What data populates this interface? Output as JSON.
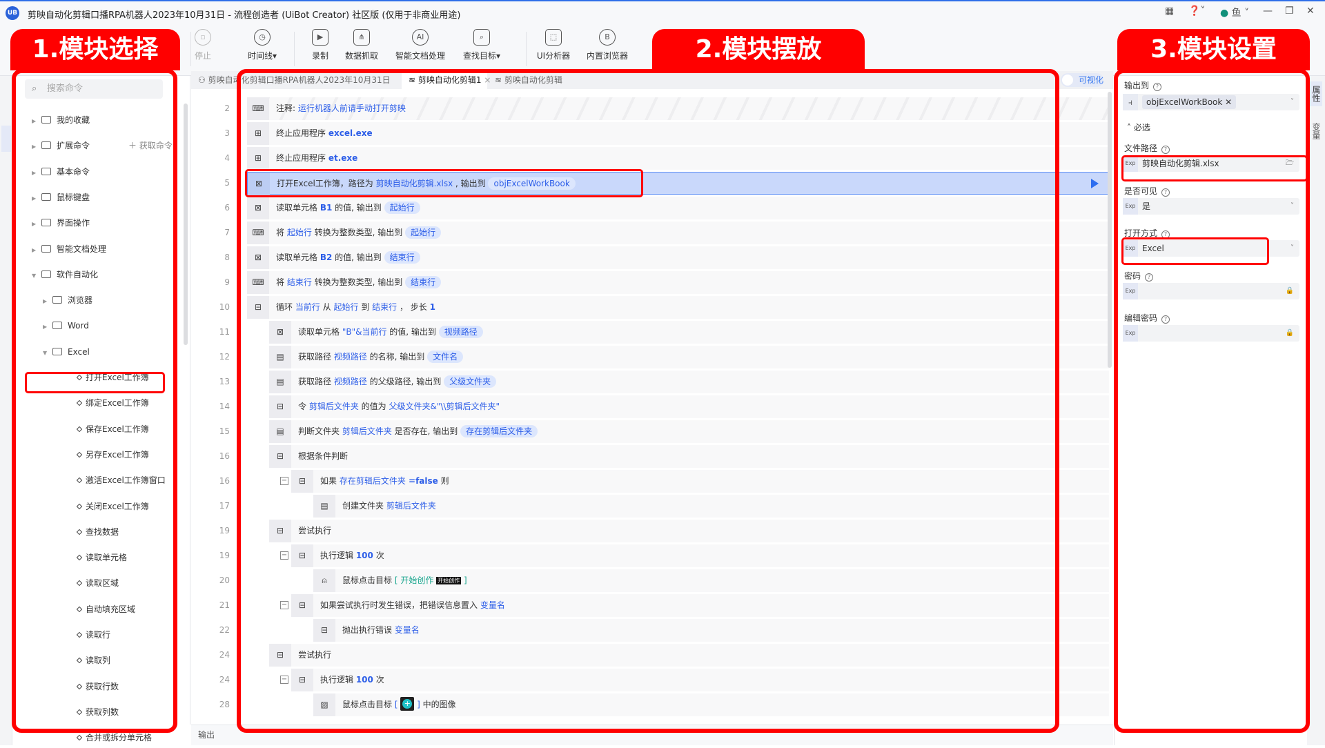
{
  "window": {
    "title": "剪映自动化剪辑口播RPA机器人2023年10月31日 - 流程创造者 (UiBot Creator) 社区版 (仅用于非商业用途)",
    "logo": "UB",
    "user": "鱼"
  },
  "toolbar": [
    {
      "label": "停止",
      "icon": "stop-icon",
      "glyph": "▫",
      "disabled": true
    },
    {
      "label": "时间线▾",
      "icon": "clock-icon",
      "glyph": "◷"
    },
    {
      "label": "录制",
      "icon": "record-icon",
      "glyph": "▶"
    },
    {
      "label": "数据抓取",
      "icon": "data-scrape-icon",
      "glyph": "⋔"
    },
    {
      "label": "智能文档处理",
      "icon": "ai-doc-icon",
      "glyph": "AI"
    },
    {
      "label": "查找目标▾",
      "icon": "find-target-icon",
      "glyph": "⌕"
    },
    {
      "label": "UI分析器",
      "icon": "ui-analyzer-icon",
      "glyph": "⬚"
    },
    {
      "label": "内置浏览器",
      "icon": "browser-icon",
      "glyph": "B"
    }
  ],
  "sidebar": {
    "search_placeholder": "搜索命令",
    "get_commands": "获取命令",
    "items": [
      {
        "label": "我的收藏",
        "level": 0,
        "type": "folder"
      },
      {
        "label": "扩展命令",
        "level": 0,
        "type": "folder"
      },
      {
        "label": "基本命令",
        "level": 0,
        "type": "folder"
      },
      {
        "label": "鼠标键盘",
        "level": 0,
        "type": "folder"
      },
      {
        "label": "界面操作",
        "level": 0,
        "type": "folder"
      },
      {
        "label": "智能文档处理",
        "level": 0,
        "type": "folder"
      },
      {
        "label": "软件自动化",
        "level": 0,
        "type": "folder",
        "open": true
      },
      {
        "label": "浏览器",
        "level": 1,
        "type": "folder"
      },
      {
        "label": "Word",
        "level": 1,
        "type": "folder"
      },
      {
        "label": "Excel",
        "level": 1,
        "type": "folder",
        "open": true
      },
      {
        "label": "打开Excel工作簿",
        "level": 2,
        "type": "cmd",
        "highlight": true
      },
      {
        "label": "绑定Excel工作簿",
        "level": 2,
        "type": "cmd"
      },
      {
        "label": "保存Excel工作簿",
        "level": 2,
        "type": "cmd"
      },
      {
        "label": "另存Excel工作簿",
        "level": 2,
        "type": "cmd"
      },
      {
        "label": "激活Excel工作簿窗口",
        "level": 2,
        "type": "cmd"
      },
      {
        "label": "关闭Excel工作簿",
        "level": 2,
        "type": "cmd"
      },
      {
        "label": "查找数据",
        "level": 2,
        "type": "cmd"
      },
      {
        "label": "读取单元格",
        "level": 2,
        "type": "cmd"
      },
      {
        "label": "读取区域",
        "level": 2,
        "type": "cmd"
      },
      {
        "label": "自动填充区域",
        "level": 2,
        "type": "cmd"
      },
      {
        "label": "读取行",
        "level": 2,
        "type": "cmd"
      },
      {
        "label": "读取列",
        "level": 2,
        "type": "cmd"
      },
      {
        "label": "获取行数",
        "level": 2,
        "type": "cmd"
      },
      {
        "label": "获取列数",
        "level": 2,
        "type": "cmd"
      },
      {
        "label": "合并或拆分单元格",
        "level": 2,
        "type": "cmd"
      }
    ]
  },
  "editor": {
    "tabs": [
      {
        "label": "剪映自动化剪辑口播RPA机器人2023年10月31日",
        "icon": "flow-icon"
      },
      {
        "label": "剪映自动化剪辑1",
        "icon": "layers-icon",
        "active": true,
        "closable": true
      },
      {
        "label": "剪映自动化剪辑",
        "icon": "layers-icon"
      }
    ],
    "visual_toggle": "可视化",
    "rows": [
      {
        "n": "2",
        "indent": 0,
        "icon": "comment-icon",
        "g": "⌨",
        "striped": true,
        "parts": [
          [
            "注释: ",
            "t"
          ],
          [
            "运行机器人前请手动打开剪映",
            "v"
          ]
        ]
      },
      {
        "n": "3",
        "indent": 0,
        "icon": "app-icon",
        "g": "⊞",
        "parts": [
          [
            "终止应用程序 ",
            "t"
          ],
          [
            "excel.exe",
            "vb"
          ]
        ]
      },
      {
        "n": "4",
        "indent": 0,
        "icon": "app-icon",
        "g": "⊞",
        "parts": [
          [
            "终止应用程序 ",
            "t"
          ],
          [
            "et.exe",
            "vb"
          ]
        ]
      },
      {
        "n": "5",
        "indent": 0,
        "icon": "excel-icon",
        "g": "⊠",
        "selected": true,
        "parts": [
          [
            "打开Excel工作簿，路径为 ",
            "t"
          ],
          [
            "剪映自动化剪辑.xlsx",
            "v"
          ],
          [
            " , 输出到 ",
            "t"
          ],
          [
            "objExcelWorkBook",
            "c"
          ]
        ]
      },
      {
        "n": "6",
        "indent": 0,
        "icon": "excel-icon",
        "g": "⊠",
        "parts": [
          [
            "读取单元格 ",
            "t"
          ],
          [
            "B1",
            "vb"
          ],
          [
            " 的值, 输出到 ",
            "t"
          ],
          [
            "起始行",
            "c"
          ]
        ]
      },
      {
        "n": "7",
        "indent": 0,
        "icon": "code-icon",
        "g": "⌨",
        "parts": [
          [
            "将 ",
            "t"
          ],
          [
            "起始行",
            "v"
          ],
          [
            " 转换为整数类型, 输出到 ",
            "t"
          ],
          [
            "起始行",
            "c"
          ]
        ]
      },
      {
        "n": "8",
        "indent": 0,
        "icon": "excel-icon",
        "g": "⊠",
        "parts": [
          [
            "读取单元格 ",
            "t"
          ],
          [
            "B2",
            "vb"
          ],
          [
            " 的值, 输出到 ",
            "t"
          ],
          [
            "结束行",
            "c"
          ]
        ]
      },
      {
        "n": "9",
        "indent": 0,
        "icon": "code-icon",
        "g": "⌨",
        "parts": [
          [
            "将 ",
            "t"
          ],
          [
            "结束行",
            "v"
          ],
          [
            " 转换为整数类型, 输出到 ",
            "t"
          ],
          [
            "结束行",
            "c"
          ]
        ]
      },
      {
        "n": "10",
        "indent": 0,
        "icon": "flow-control-icon",
        "g": "⊟",
        "parts": [
          [
            "循环 ",
            "t"
          ],
          [
            "当前行",
            "v"
          ],
          [
            " 从 ",
            "t"
          ],
          [
            "起始行",
            "v"
          ],
          [
            " 到 ",
            "t"
          ],
          [
            "结束行",
            "v"
          ],
          [
            " ， 步长 ",
            "t"
          ],
          [
            "1",
            "vb"
          ]
        ]
      },
      {
        "n": "11",
        "indent": 1,
        "icon": "excel-icon",
        "g": "⊠",
        "parts": [
          [
            "读取单元格 ",
            "t"
          ],
          [
            "\"B\"&当前行",
            "v"
          ],
          [
            " 的值, 输出到 ",
            "t"
          ],
          [
            "视频路径",
            "c"
          ]
        ]
      },
      {
        "n": "12",
        "indent": 1,
        "icon": "file-icon",
        "g": "▤",
        "parts": [
          [
            "获取路径 ",
            "t"
          ],
          [
            "视频路径",
            "v"
          ],
          [
            " 的名称, 输出到 ",
            "t"
          ],
          [
            "文件名",
            "c"
          ]
        ]
      },
      {
        "n": "13",
        "indent": 1,
        "icon": "file-icon",
        "g": "▤",
        "parts": [
          [
            "获取路径 ",
            "t"
          ],
          [
            "视频路径",
            "v"
          ],
          [
            " 的父级路径, 输出到 ",
            "t"
          ],
          [
            "父级文件夹",
            "c"
          ]
        ]
      },
      {
        "n": "14",
        "indent": 1,
        "icon": "flow-control-icon",
        "g": "⊟",
        "parts": [
          [
            "令 ",
            "t"
          ],
          [
            "剪辑后文件夹",
            "v"
          ],
          [
            " 的值为 ",
            "t"
          ],
          [
            "父级文件夹&\"\\\\剪辑后文件夹\"",
            "v"
          ]
        ]
      },
      {
        "n": "15",
        "indent": 1,
        "icon": "file-icon",
        "g": "▤",
        "parts": [
          [
            "判断文件夹 ",
            "t"
          ],
          [
            "剪辑后文件夹",
            "v"
          ],
          [
            " 是否存在, 输出到 ",
            "t"
          ],
          [
            "存在剪辑后文件夹",
            "c"
          ]
        ]
      },
      {
        "n": "16",
        "indent": 1,
        "icon": "flow-control-icon",
        "g": "⊟",
        "parts": [
          [
            "根据条件判断",
            "t"
          ]
        ]
      },
      {
        "n": "16",
        "indent": 2,
        "icon": "flow-control-icon",
        "g": "⊟",
        "fold": true,
        "parts": [
          [
            "如果 ",
            "t"
          ],
          [
            "存在剪辑后文件夹",
            "v"
          ],
          [
            " =false",
            "vb"
          ],
          [
            " 则",
            "t"
          ]
        ]
      },
      {
        "n": "17",
        "indent": 3,
        "icon": "file-icon",
        "g": "▤",
        "parts": [
          [
            "创建文件夹 ",
            "t"
          ],
          [
            "剪辑后文件夹",
            "v"
          ]
        ]
      },
      {
        "n": "19",
        "indent": 1,
        "icon": "flow-control-icon",
        "g": "⊟",
        "parts": [
          [
            "尝试执行",
            "t"
          ]
        ]
      },
      {
        "n": "19",
        "indent": 2,
        "icon": "flow-control-icon",
        "g": "⊟",
        "fold": true,
        "parts": [
          [
            "执行逻辑 ",
            "t"
          ],
          [
            "100",
            "vb"
          ],
          [
            " 次",
            "t"
          ]
        ]
      },
      {
        "n": "20",
        "indent": 3,
        "icon": "mouse-icon",
        "g": "⍝",
        "parts": [
          [
            "鼠标点击目标 ",
            "t"
          ],
          [
            "[ 开始创作 ",
            "gr"
          ],
          [
            "开始创作",
            "th"
          ],
          [
            " ]",
            "gr"
          ]
        ]
      },
      {
        "n": "21",
        "indent": 2,
        "icon": "flow-control-icon",
        "g": "⊟",
        "fold": true,
        "parts": [
          [
            "如果尝试执行时发生错误，把错误信息置入 ",
            "t"
          ],
          [
            "变量名",
            "v"
          ]
        ]
      },
      {
        "n": "22",
        "indent": 3,
        "icon": "flow-control-icon",
        "g": "⊟",
        "parts": [
          [
            "抛出执行错误 ",
            "t"
          ],
          [
            "变量名",
            "v"
          ]
        ]
      },
      {
        "n": "24",
        "indent": 1,
        "icon": "flow-control-icon",
        "g": "⊟",
        "parts": [
          [
            "尝试执行",
            "t"
          ]
        ]
      },
      {
        "n": "24",
        "indent": 2,
        "icon": "flow-control-icon",
        "g": "⊟",
        "fold": true,
        "parts": [
          [
            "执行逻辑 ",
            "t"
          ],
          [
            "100",
            "vb"
          ],
          [
            " 次",
            "t"
          ]
        ]
      },
      {
        "n": "28",
        "indent": 3,
        "icon": "image-icon",
        "g": "▨",
        "parts": [
          [
            "鼠标点击目标 ",
            "t"
          ],
          [
            "[ ",
            "v"
          ],
          [
            "",
            "img"
          ],
          [
            " ] ",
            "v"
          ],
          [
            "中的图像",
            "t"
          ]
        ]
      }
    ],
    "output_label": "输出"
  },
  "properties": {
    "output_to": {
      "label": "输出到",
      "value": "objExcelWorkBook"
    },
    "required_section": "必选",
    "fields": [
      {
        "label": "文件路径",
        "value": "剪映自动化剪辑.xlsx",
        "end": "folder-icon"
      },
      {
        "label": "是否可见",
        "value": "是",
        "end": "chevron-down-icon"
      },
      {
        "label": "打开方式",
        "value": "Excel",
        "end": "chevron-down-icon"
      },
      {
        "label": "密码",
        "value": "",
        "end": "lock-icon"
      },
      {
        "label": "编辑密码",
        "value": "",
        "end": "lock-icon"
      }
    ],
    "exp": "Exp",
    "rail_tabs": [
      "属性",
      "变量"
    ]
  },
  "annotations": [
    "1.模块选择",
    "2.模块摆放",
    "3.模块设置"
  ],
  "colors": {
    "accent": "#2d5ee8",
    "annotation": "#ff0000",
    "selected_row": "#c9d8fb",
    "chip": "#dce6fd",
    "green": "#18a58d"
  }
}
